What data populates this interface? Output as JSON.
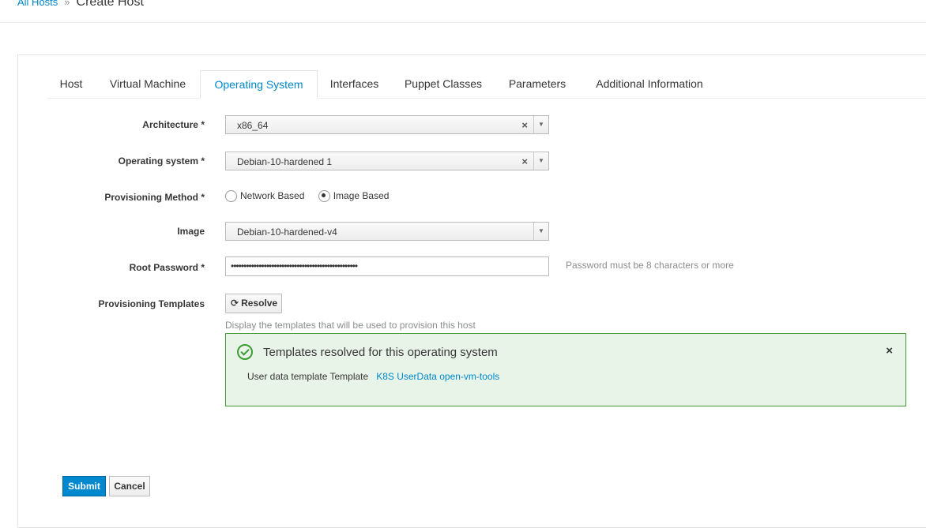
{
  "breadcrumb": {
    "parent": "All Hosts",
    "separator": "»",
    "current": "Create Host"
  },
  "tabs": [
    {
      "label": "Host",
      "active": false
    },
    {
      "label": "Virtual Machine",
      "active": false
    },
    {
      "label": "Operating System",
      "active": true
    },
    {
      "label": "Interfaces",
      "active": false
    },
    {
      "label": "Puppet Classes",
      "active": false
    },
    {
      "label": "Parameters",
      "active": false
    },
    {
      "label": "Additional Information",
      "active": false
    }
  ],
  "form": {
    "architecture": {
      "label": "Architecture *",
      "value": "x86_64"
    },
    "operating_system": {
      "label": "Operating system *",
      "value": "Debian-10-hardened 1"
    },
    "provisioning_method": {
      "label": "Provisioning Method *",
      "options": [
        {
          "label": "Network Based",
          "checked": false
        },
        {
          "label": "Image Based",
          "checked": true
        }
      ]
    },
    "image": {
      "label": "Image",
      "value": "Debian-10-hardened-v4"
    },
    "root_password": {
      "label": "Root Password *",
      "masked_value": "••••••••••••••••••••••••••••••••••••••••••••••••••",
      "help": "Password must be 8 characters or more"
    },
    "provisioning_templates": {
      "label": "Provisioning Templates",
      "resolve_button": "Resolve",
      "help": "Display the templates that will be used to provision this host"
    }
  },
  "alert": {
    "status_color": "#3f9c35",
    "title": "Templates resolved for this operating system",
    "close": "×",
    "line_label": "User data template Template",
    "line_link": "K8S UserData open-vm-tools"
  },
  "actions": {
    "submit": "Submit",
    "cancel": "Cancel"
  },
  "colors": {
    "accent": "#0088ce",
    "success": "#3f9c35"
  }
}
